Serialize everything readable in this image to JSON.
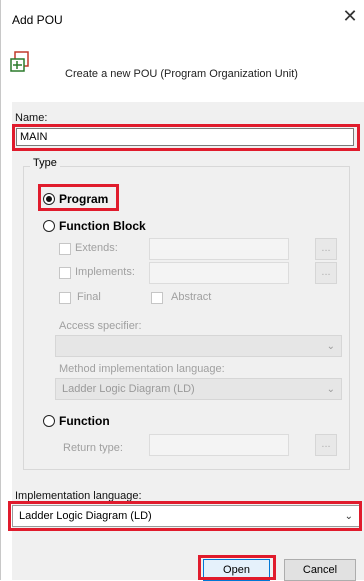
{
  "dialog": {
    "title": "Add POU",
    "close_glyph": "✕",
    "description": "Create a new POU (Program Organization Unit)",
    "header_icon": "add-pou-icon"
  },
  "name": {
    "label": "Name:",
    "value": "MAIN"
  },
  "type": {
    "legend": "Type",
    "program_label": "Program",
    "function_block_label": "Function Block",
    "extends_label": "Extends:",
    "implements_label": "Implements:",
    "final_label": "Final",
    "abstract_label": "Abstract",
    "access_specifier_label": "Access specifier:",
    "method_lang_label": "Method implementation language:",
    "method_lang_value": "Ladder Logic Diagram (LD)",
    "function_label": "Function",
    "return_type_label": "Return type:",
    "browse_label": "...",
    "selected": "Program"
  },
  "implementation": {
    "label": "Implementation language:",
    "value": "Ladder Logic Diagram (LD)"
  },
  "buttons": {
    "open": "Open",
    "cancel": "Cancel"
  },
  "colors": {
    "highlight": "#e01b2c",
    "panel": "#f0f0f0"
  }
}
